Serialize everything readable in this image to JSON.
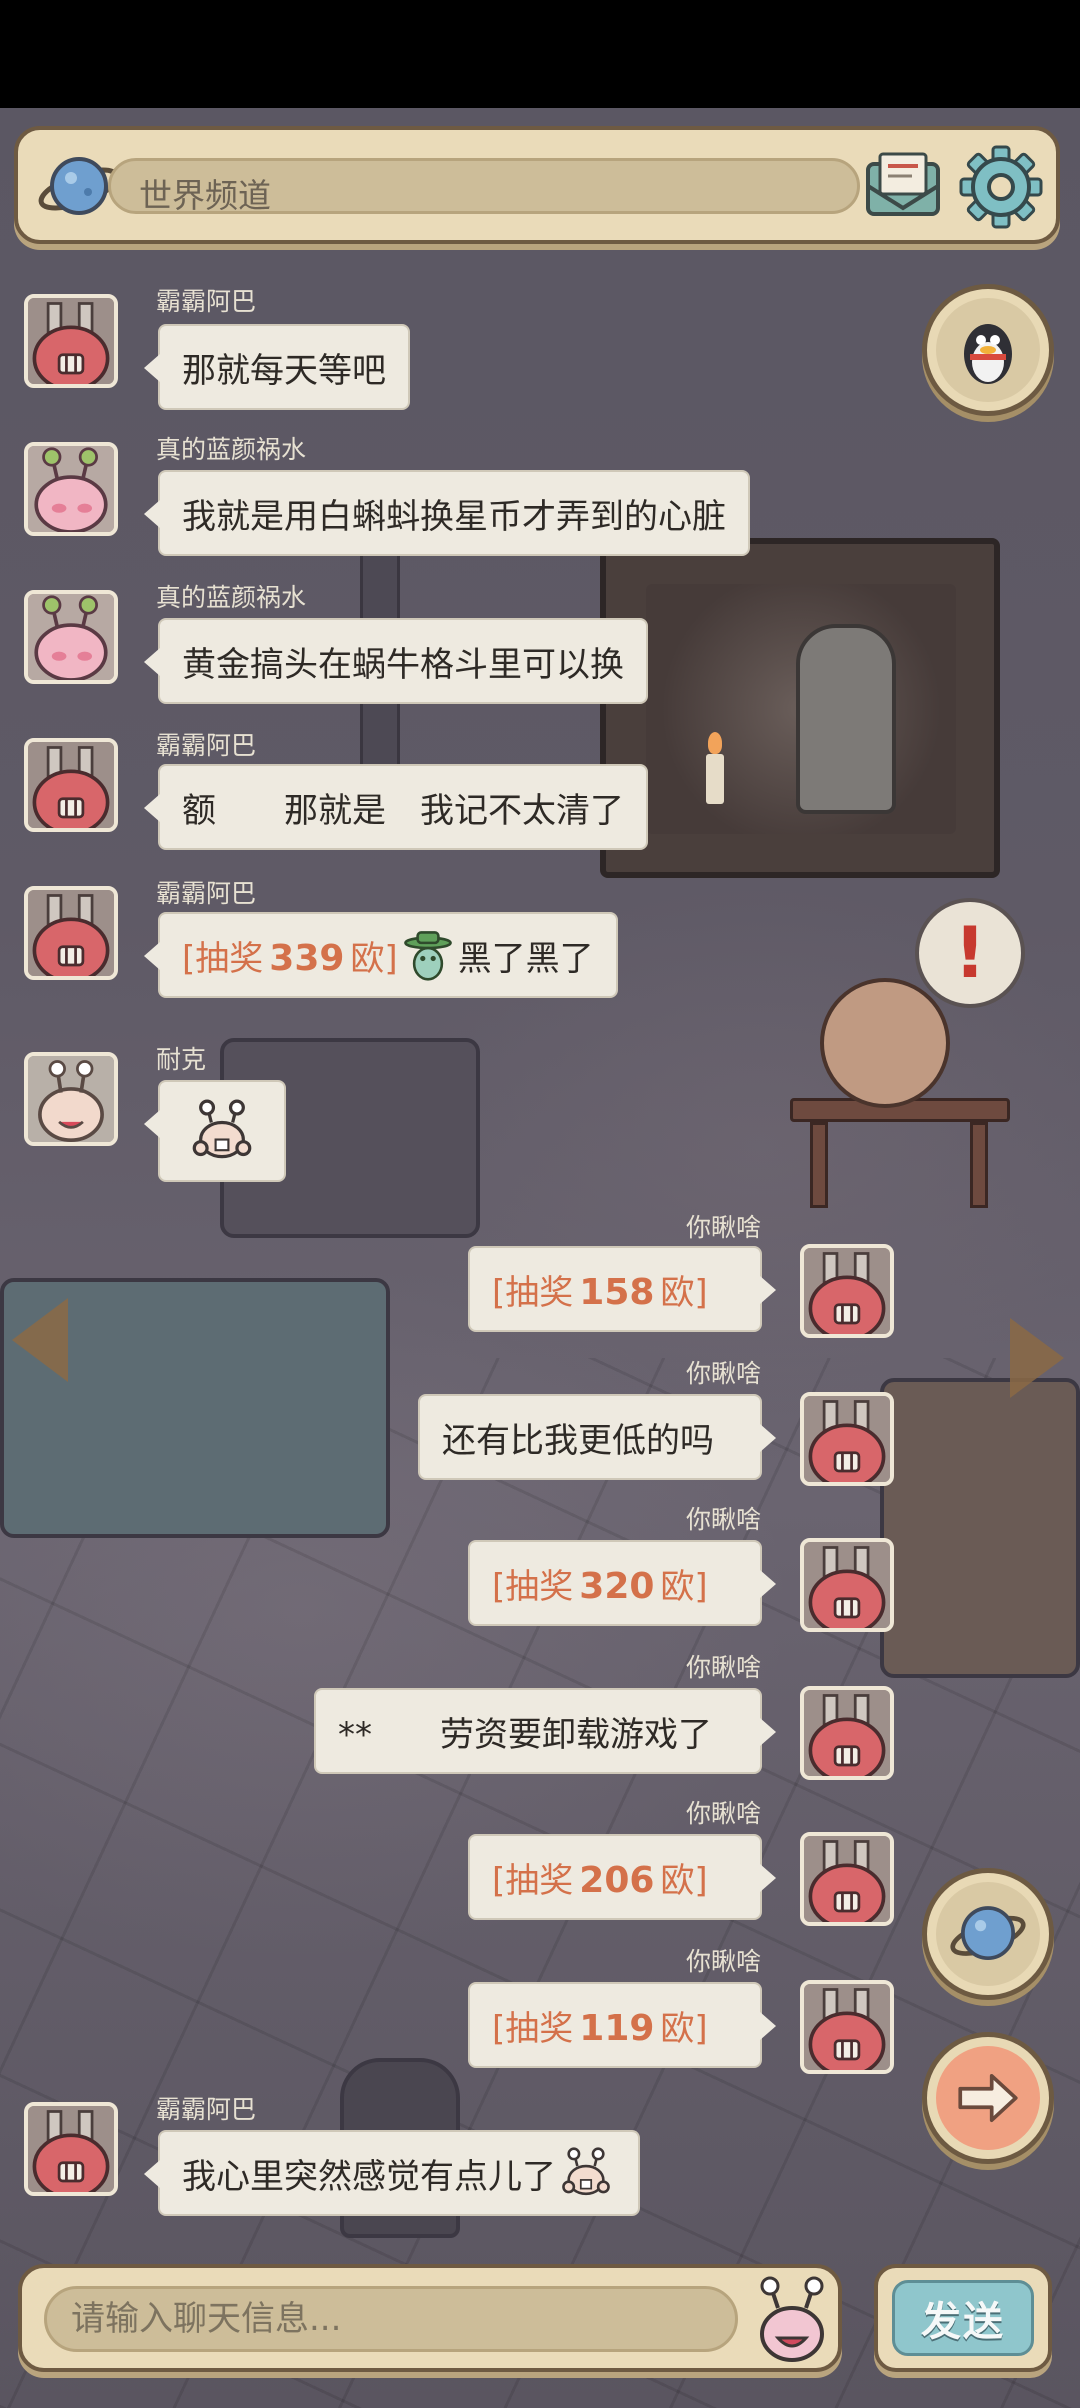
{
  "header": {
    "channel_label": "世界频道"
  },
  "messages": [
    {
      "side": "left",
      "name": "霸霸阿巴",
      "avatar": "red-monster-avatar",
      "text": "那就每天等吧"
    },
    {
      "side": "left",
      "name": "真的蓝颜祸水",
      "avatar": "pink-snail-avatar",
      "text": "我就是用白蝌蚪换星币才弄到的心脏"
    },
    {
      "side": "left",
      "name": "真的蓝颜祸水",
      "avatar": "pink-snail-avatar",
      "text": "黄金搞头在蜗牛格斗里可以换"
    },
    {
      "side": "left",
      "name": "霸霸阿巴",
      "avatar": "red-monster-avatar",
      "text": "额　　那就是　我记不太清了"
    },
    {
      "side": "left",
      "name": "霸霸阿巴",
      "avatar": "red-monster-avatar",
      "lottery": {
        "prefix": "[抽奖",
        "amount": "339",
        "suffix": "欧]"
      },
      "after_text": "黑了黑了"
    },
    {
      "side": "left",
      "name": "耐克",
      "avatar": "snail-avatar",
      "emoji_only": true
    },
    {
      "side": "right",
      "name": "你瞅啥",
      "avatar": "red-monster-avatar",
      "lottery": {
        "prefix": "[抽奖",
        "amount": "158",
        "suffix": "欧]"
      }
    },
    {
      "side": "right",
      "name": "你瞅啥",
      "avatar": "red-monster-avatar",
      "text": "还有比我更低的吗"
    },
    {
      "side": "right",
      "name": "你瞅啥",
      "avatar": "red-monster-avatar",
      "lottery": {
        "prefix": "[抽奖",
        "amount": "320",
        "suffix": "欧]"
      }
    },
    {
      "side": "right",
      "name": "你瞅啥",
      "avatar": "red-monster-avatar",
      "text": "**　　劳资要卸载游戏了"
    },
    {
      "side": "right",
      "name": "你瞅啥",
      "avatar": "red-monster-avatar",
      "lottery": {
        "prefix": "[抽奖",
        "amount": "206",
        "suffix": "欧]"
      }
    },
    {
      "side": "right",
      "name": "你瞅啥",
      "avatar": "red-monster-avatar",
      "lottery": {
        "prefix": "[抽奖",
        "amount": "119",
        "suffix": "欧]"
      }
    },
    {
      "side": "left",
      "name": "霸霸阿巴",
      "avatar": "red-monster-avatar",
      "text": "我心里突然感觉有点儿了"
    }
  ],
  "input": {
    "placeholder": "请输入聊天信息..."
  },
  "send_label": "发送",
  "colors": {
    "panel": "#eadbb9",
    "panel_border": "#6e5a42",
    "bubble": "#eeeae0",
    "lottery": "#d4714a",
    "send": "#8fc6cc"
  }
}
